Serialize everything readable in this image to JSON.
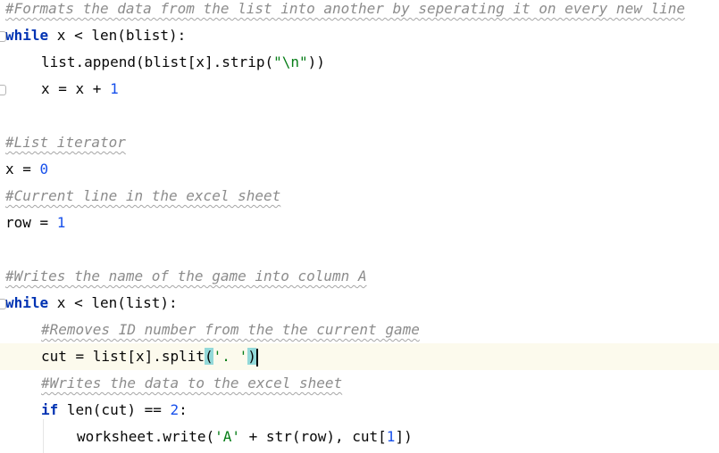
{
  "editor": {
    "language": "python",
    "current_line_index": 13,
    "colors": {
      "background": "#ffffff",
      "current_line": "#fcfaed",
      "comment": "#8c8c8c",
      "keyword": "#0033b3",
      "number": "#1750eb",
      "string": "#067d17",
      "bracket_match": "#93d9d9"
    },
    "lines": [
      {
        "tokens": [
          {
            "t": "#Formats the data from the list into another by seperating it on every new line",
            "c": "comment"
          }
        ]
      },
      {
        "tokens": [
          {
            "t": "while",
            "c": "kw"
          },
          {
            "t": " x < len(blist):",
            "c": ""
          }
        ]
      },
      {
        "tokens": [
          {
            "t": "list.append(blist[x].strip(",
            "c": ""
          },
          {
            "t": "\"\\n\"",
            "c": "str"
          },
          {
            "t": "))",
            "c": ""
          }
        ]
      },
      {
        "tokens": [
          {
            "t": "x = x + ",
            "c": ""
          },
          {
            "t": "1",
            "c": "num"
          }
        ]
      },
      {
        "tokens": []
      },
      {
        "tokens": [
          {
            "t": "#List iterator",
            "c": "comment"
          }
        ]
      },
      {
        "tokens": [
          {
            "t": "x = ",
            "c": ""
          },
          {
            "t": "0",
            "c": "num"
          }
        ]
      },
      {
        "tokens": [
          {
            "t": "#Current line in the excel sheet",
            "c": "comment"
          }
        ]
      },
      {
        "tokens": [
          {
            "t": "row = ",
            "c": ""
          },
          {
            "t": "1",
            "c": "num"
          }
        ]
      },
      {
        "tokens": []
      },
      {
        "tokens": [
          {
            "t": "#Writes the name of the game into column A",
            "c": "comment"
          }
        ]
      },
      {
        "tokens": [
          {
            "t": "while",
            "c": "kw"
          },
          {
            "t": " x < len(list):",
            "c": ""
          }
        ]
      },
      {
        "tokens": [
          {
            "t": "#Removes ID number from the the current game",
            "c": "comment"
          }
        ]
      },
      {
        "tokens": [
          {
            "t": "cut = list[x].split",
            "c": ""
          },
          {
            "t": "(",
            "c": "paren-hl"
          },
          {
            "t": "'. '",
            "c": "str"
          },
          {
            "t": ")",
            "c": "paren-hl"
          }
        ]
      },
      {
        "tokens": [
          {
            "t": "#Writes the data to the excel sheet",
            "c": "comment"
          }
        ]
      },
      {
        "tokens": [
          {
            "t": "if",
            "c": "kw"
          },
          {
            "t": " len(cut) == ",
            "c": ""
          },
          {
            "t": "2",
            "c": "num"
          },
          {
            "t": ":",
            "c": ""
          }
        ]
      },
      {
        "tokens": [
          {
            "t": "worksheet.write(",
            "c": ""
          },
          {
            "t": "'A'",
            "c": "str"
          },
          {
            "t": " + str(row), cut[",
            "c": ""
          },
          {
            "t": "1",
            "c": "num"
          },
          {
            "t": "])",
            "c": ""
          }
        ]
      }
    ]
  }
}
